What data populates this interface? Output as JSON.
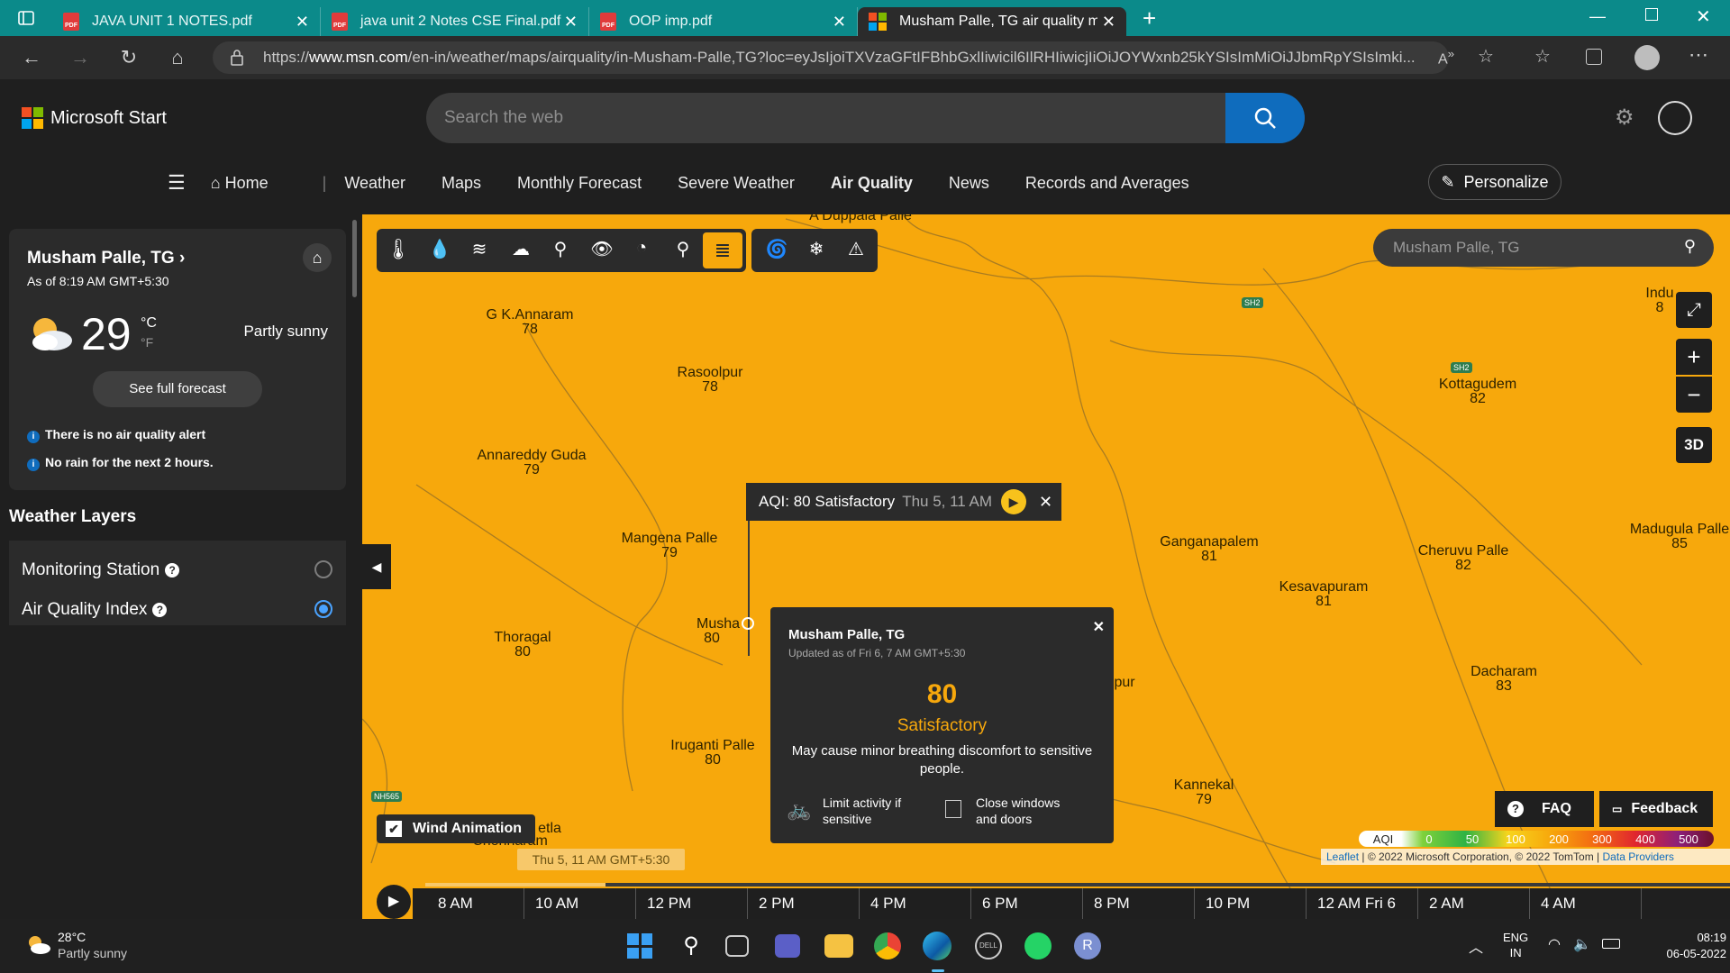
{
  "browser": {
    "tabs": [
      {
        "label": "JAVA UNIT 1 NOTES.pdf",
        "icon": "pdf-icon"
      },
      {
        "label": "java unit 2 Notes CSE Final.pdf",
        "icon": "pdf-icon"
      },
      {
        "label": "OOP imp.pdf",
        "icon": "pdf-icon"
      },
      {
        "label": "Musham Palle, TG air quality ma",
        "icon": "microsoft-icon",
        "active": true
      }
    ],
    "url_prefix": "https://",
    "url_domain": "www.msn.com",
    "url_rest": "/en-in/weather/maps/airquality/in-Musham-Palle,TG?loc=eyJsIjoiTXVzaGFtIFBhbGxlIiwicil6IlRHIiwicjIiOiJOYWxnb25kYSIsImMiOiJJbmRpYSIsImki..."
  },
  "site": {
    "brand": "Microsoft Start",
    "search_placeholder": "Search the web",
    "nav": [
      "Home",
      "Weather",
      "Maps",
      "Monthly Forecast",
      "Severe Weather",
      "Air Quality",
      "News",
      "Records and Averages"
    ],
    "personalize": "Personalize"
  },
  "weather_card": {
    "location": "Musham Palle, TG",
    "as_of": "As of 8:19 AM GMT+5:30",
    "temp": "29",
    "unit_c": "°C",
    "unit_f": "°F",
    "condition": "Partly sunny",
    "forecast_btn": "See full forecast",
    "alert1": "There is no air quality alert",
    "alert2": "No rain for the next 2 hours."
  },
  "layers": {
    "title": "Weather Layers",
    "items": [
      {
        "label": "Monitoring Station",
        "selected": false
      },
      {
        "label": "Air Quality Index",
        "selected": true
      }
    ]
  },
  "map": {
    "search_value": "Musham Palle, TG",
    "btn_3d": "3D",
    "towns": [
      {
        "name": "A Duppala Palle",
        "aqi": ""
      },
      {
        "name": "G K.Annaram",
        "aqi": "78"
      },
      {
        "name": "Rasoolpur",
        "aqi": "78"
      },
      {
        "name": "Annareddy Guda",
        "aqi": "79"
      },
      {
        "name": "Mangena Palle",
        "aqi": "79"
      },
      {
        "name": "Musha",
        "aqi": "80"
      },
      {
        "name": "Thoragal",
        "aqi": "80"
      },
      {
        "name": "Iruganti Palle",
        "aqi": "80"
      },
      {
        "name": "etla",
        "aqi": ""
      },
      {
        "name": "Chenharam",
        "aqi": ""
      },
      {
        "name": "Ganganapalem",
        "aqi": "81"
      },
      {
        "name": "Kesavapuram",
        "aqi": "81"
      },
      {
        "name": "Cheruvu Palle",
        "aqi": "82"
      },
      {
        "name": "Kottagudem",
        "aqi": "82"
      },
      {
        "name": "Madugula Palle",
        "aqi": "85"
      },
      {
        "name": "Dacharam",
        "aqi": "83"
      },
      {
        "name": "Kannekal",
        "aqi": "79"
      },
      {
        "name": "Indu",
        "aqi": "8"
      },
      {
        "name": "pur",
        "aqi": ""
      }
    ],
    "road_labels": [
      "SH2",
      "SH2",
      "NH565"
    ],
    "aqi_tooltip": {
      "label": "AQI: 80 Satisfactory",
      "time": "Thu 5, 11 AM"
    },
    "popup": {
      "title": "Musham Palle, TG",
      "updated": "Updated as of Fri 6, 7 AM GMT+5:30",
      "value": "80",
      "status": "Satisfactory",
      "desc": "May cause minor breathing discomfort to sensitive people.",
      "tip1": "Limit activity if sensitive",
      "tip2": "Close windows and doors",
      "status_color": "#f7a80c"
    },
    "wind_animation": "Wind Animation",
    "faq": "FAQ",
    "feedback": "Feedback",
    "legend": {
      "label": "AQI",
      "values": [
        "0",
        "50",
        "100",
        "200",
        "300",
        "400",
        "500"
      ]
    },
    "attribution": {
      "leaflet": "Leaflet",
      "text": " | © 2022 Microsoft Corporation, © 2022 TomTom | ",
      "providers": "Data Providers"
    },
    "timeline": {
      "current": "Thu 5, 11 AM GMT+5:30",
      "labels": [
        "8 AM",
        "10 AM",
        "12 PM",
        "2 PM",
        "4 PM",
        "6 PM",
        "8 PM",
        "10 PM",
        "12 AM Fri 6",
        "2 AM",
        "4 AM"
      ]
    }
  },
  "taskbar": {
    "temp": "28°C",
    "condition": "Partly sunny",
    "lang1": "ENG",
    "lang2": "IN",
    "time": "08:19",
    "date": "06-05-2022"
  }
}
